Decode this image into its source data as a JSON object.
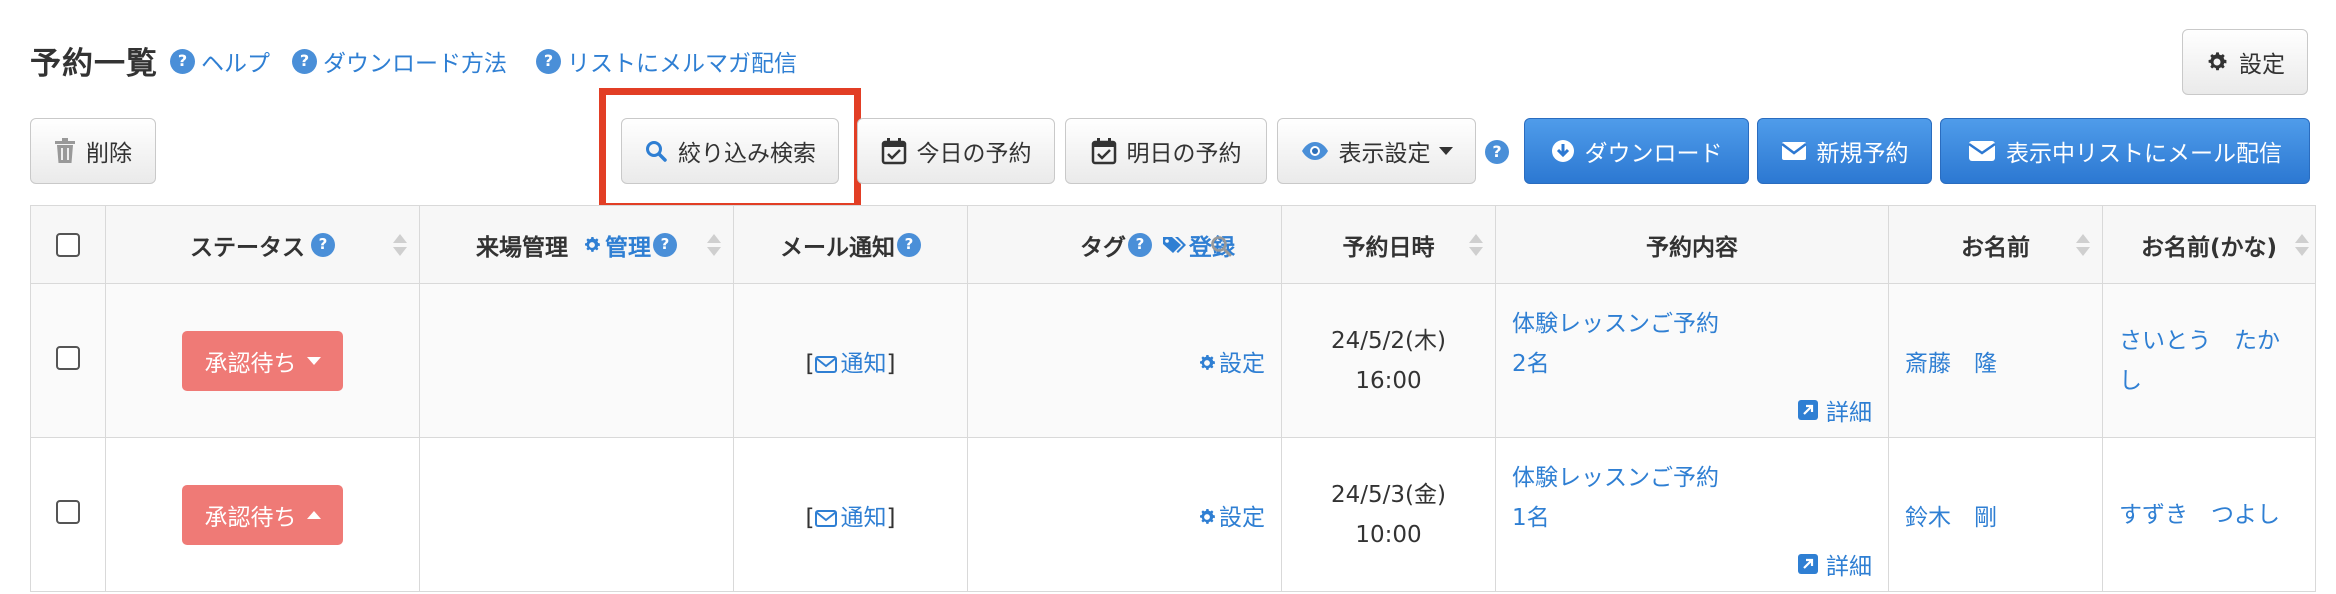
{
  "header": {
    "title": "予約一覧",
    "help_links": [
      {
        "label": "ヘルプ"
      },
      {
        "label": "ダウンロード方法"
      },
      {
        "label": "リストにメルマガ配信"
      }
    ],
    "settings_label": "設定"
  },
  "toolbar": {
    "delete_label": "削除",
    "filter_search_label": "絞り込み検索",
    "today_label": "今日の予約",
    "tomorrow_label": "明日の予約",
    "display_settings_label": "表示設定",
    "download_label": "ダウンロード",
    "new_reservation_label": "新規予約",
    "mail_list_label": "表示中リストにメール配信"
  },
  "table": {
    "headers": {
      "status": "ステータス",
      "venue": "来場管理",
      "venue_manage_link": "管理",
      "mail": "メール通知",
      "tag": "タグ",
      "tag_register_link": "登録",
      "datetime": "予約日時",
      "content": "予約内容",
      "name": "お名前",
      "name_kana": "お名前(かな)"
    },
    "rows": [
      {
        "status": "承認待ち",
        "mail_bracket_open": "[",
        "mail_link": "通知",
        "mail_bracket_close": "]",
        "tag_setting": "設定",
        "date": "24/5/2(木)",
        "time": "16:00",
        "content_title": "体験レッスンご予約",
        "content_count": "2名",
        "detail_label": "詳細",
        "name": "斎藤　隆",
        "kana_line1": "さいとう　たか",
        "kana_line2": "し"
      },
      {
        "status": "承認待ち",
        "mail_bracket_open": "[",
        "mail_link": "通知",
        "mail_bracket_close": "]",
        "tag_setting": "設定",
        "date": "24/5/3(金)",
        "time": "10:00",
        "content_title": "体験レッスンご予約",
        "content_count": "1名",
        "detail_label": "詳細",
        "name": "鈴木　剛",
        "kana_line1": "すずき　つよし",
        "kana_line2": ""
      }
    ]
  },
  "colors": {
    "link": "#2f7fd3",
    "primary_button": "#3a86dd",
    "status_pending": "#ef7a76",
    "highlight": "#e23e25"
  }
}
